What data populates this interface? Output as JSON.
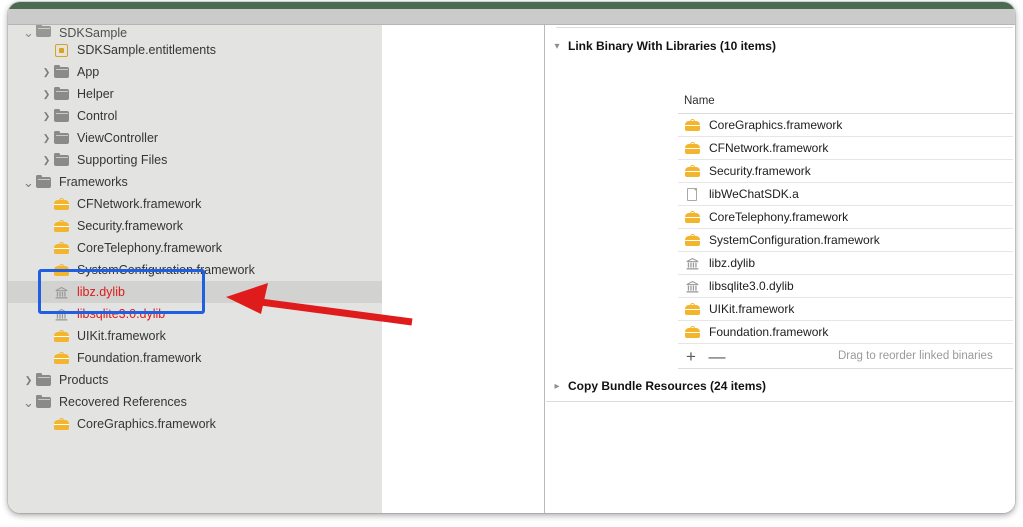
{
  "window": {
    "accent_red": "#e01b1b",
    "accent_blue": "#1f5fe0",
    "folder_icon_color": "#8a8a8a",
    "framework_icon_color": "#f3b52c"
  },
  "sidebar": {
    "items": [
      {
        "label": "SDKSample",
        "icon": "folder-icon",
        "indent": 0,
        "disclosure": "down",
        "selected": false,
        "red": false,
        "clipped": true
      },
      {
        "label": "SDKSample.entitlements",
        "icon": "entitlements-icon",
        "indent": 1,
        "disclosure": "none",
        "selected": false,
        "red": false
      },
      {
        "label": "App",
        "icon": "folder-icon",
        "indent": 1,
        "disclosure": "right",
        "selected": false,
        "red": false
      },
      {
        "label": "Helper",
        "icon": "folder-icon",
        "indent": 1,
        "disclosure": "right",
        "selected": false,
        "red": false
      },
      {
        "label": "Control",
        "icon": "folder-icon",
        "indent": 1,
        "disclosure": "right",
        "selected": false,
        "red": false
      },
      {
        "label": "ViewController",
        "icon": "folder-icon",
        "indent": 1,
        "disclosure": "right",
        "selected": false,
        "red": false
      },
      {
        "label": "Supporting Files",
        "icon": "folder-icon",
        "indent": 1,
        "disclosure": "right",
        "selected": false,
        "red": false
      },
      {
        "label": "Frameworks",
        "icon": "folder-icon",
        "indent": 0,
        "disclosure": "down",
        "selected": false,
        "red": false
      },
      {
        "label": "CFNetwork.framework",
        "icon": "framework-icon",
        "indent": 1,
        "disclosure": "none",
        "selected": false,
        "red": false
      },
      {
        "label": "Security.framework",
        "icon": "framework-icon",
        "indent": 1,
        "disclosure": "none",
        "selected": false,
        "red": false
      },
      {
        "label": "CoreTelephony.framework",
        "icon": "framework-icon",
        "indent": 1,
        "disclosure": "none",
        "selected": false,
        "red": false
      },
      {
        "label": "SystemConfiguration.framework",
        "icon": "framework-icon",
        "indent": 1,
        "disclosure": "none",
        "selected": false,
        "red": false
      },
      {
        "label": "libz.dylib",
        "icon": "dylib-icon",
        "indent": 1,
        "disclosure": "none",
        "selected": true,
        "red": true
      },
      {
        "label": "libsqlite3.0.dylib",
        "icon": "dylib-icon",
        "indent": 1,
        "disclosure": "none",
        "selected": false,
        "red": true
      },
      {
        "label": "UIKit.framework",
        "icon": "framework-icon",
        "indent": 1,
        "disclosure": "none",
        "selected": false,
        "red": false
      },
      {
        "label": "Foundation.framework",
        "icon": "framework-icon",
        "indent": 1,
        "disclosure": "none",
        "selected": false,
        "red": false
      },
      {
        "label": "Products",
        "icon": "folder-icon",
        "indent": 0,
        "disclosure": "right",
        "selected": false,
        "red": false
      },
      {
        "label": "Recovered References",
        "icon": "folder-icon",
        "indent": 0,
        "disclosure": "down",
        "selected": false,
        "red": false
      },
      {
        "label": "CoreGraphics.framework",
        "icon": "framework-icon",
        "indent": 1,
        "disclosure": "none",
        "selected": false,
        "red": false
      }
    ]
  },
  "inspector": {
    "link_phase": {
      "title": "Link Binary With Libraries (10 items)",
      "disclosure": "down",
      "column_header": "Name",
      "rows": [
        {
          "name": "CoreGraphics.framework",
          "icon": "framework-icon"
        },
        {
          "name": "CFNetwork.framework",
          "icon": "framework-icon"
        },
        {
          "name": "Security.framework",
          "icon": "framework-icon"
        },
        {
          "name": "libWeChatSDK.a",
          "icon": "document-icon"
        },
        {
          "name": "CoreTelephony.framework",
          "icon": "framework-icon"
        },
        {
          "name": "SystemConfiguration.framework",
          "icon": "framework-icon"
        },
        {
          "name": "libz.dylib",
          "icon": "dylib-icon"
        },
        {
          "name": "libsqlite3.0.dylib",
          "icon": "dylib-icon"
        },
        {
          "name": "UIKit.framework",
          "icon": "framework-icon"
        },
        {
          "name": "Foundation.framework",
          "icon": "framework-icon"
        }
      ],
      "add_label": "+",
      "remove_label": "—",
      "drag_hint": "Drag to reorder linked binaries"
    },
    "copy_phase": {
      "title": "Copy Bundle Resources (24 items)",
      "disclosure": "right"
    }
  },
  "annotations": {
    "highlight_box": {
      "label": "blue-highlight-box"
    },
    "arrow": {
      "label": "red-pointer-arrow",
      "color": "#e01b1b"
    }
  }
}
